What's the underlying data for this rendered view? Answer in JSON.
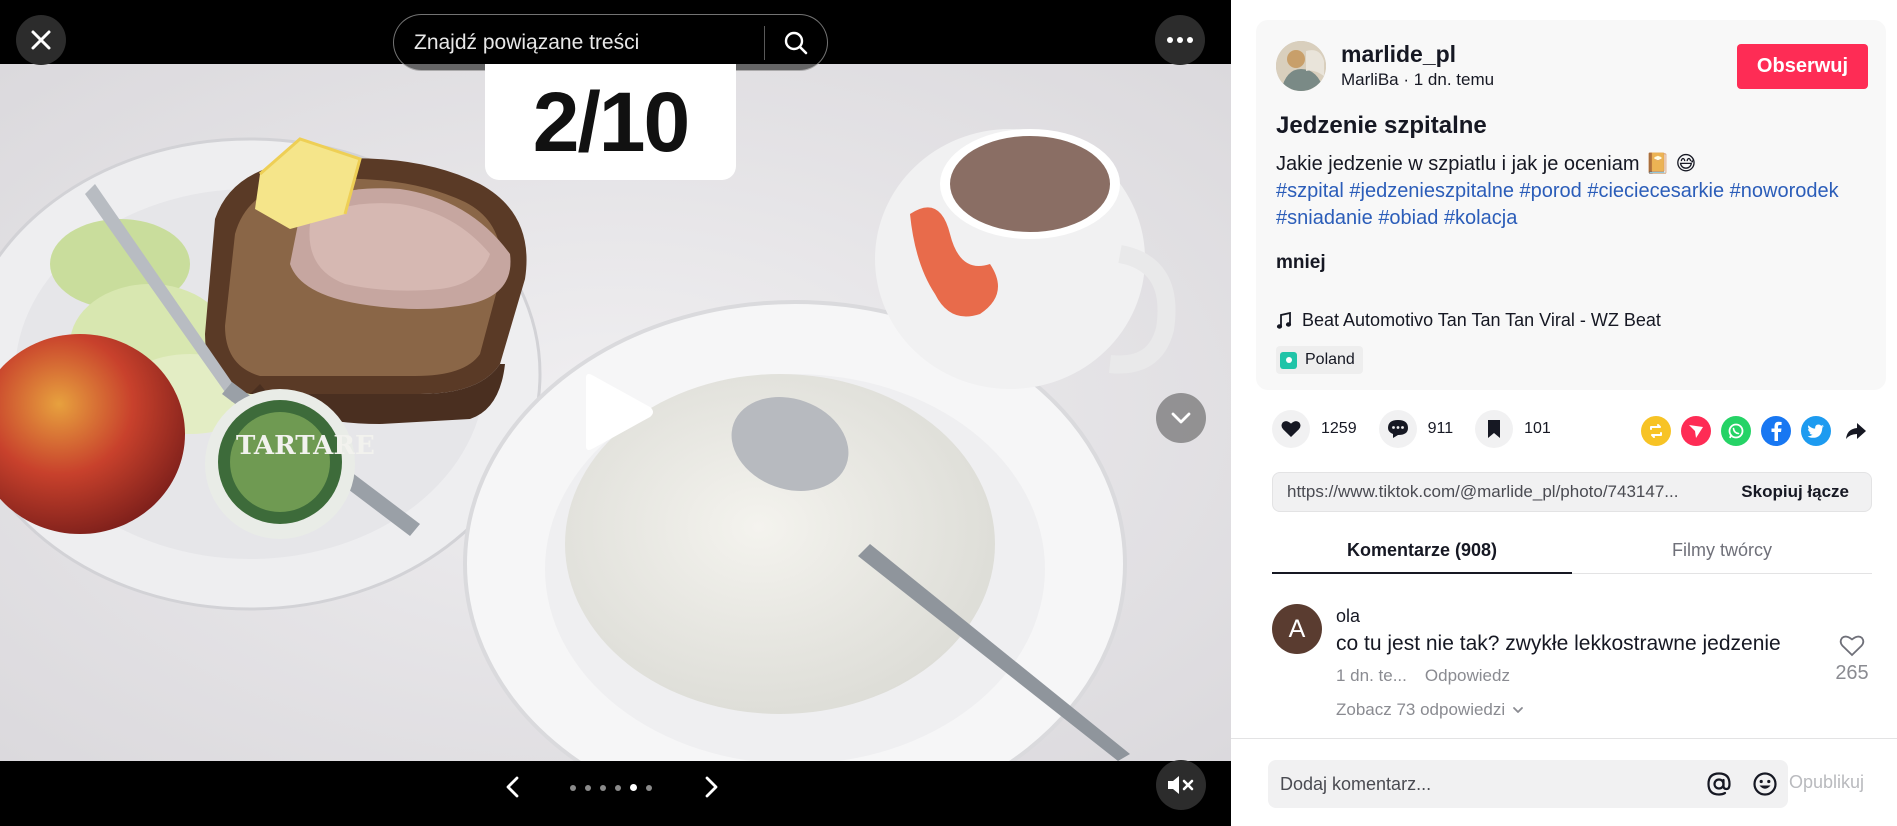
{
  "viewer": {
    "search_placeholder": "Znajdź powiązane treści",
    "slide_counter": "2/10",
    "slide_dots": {
      "total": 6,
      "active_index": 4
    }
  },
  "author": {
    "username": "marlide_pl",
    "display_name": "MarliBa",
    "separator": " · ",
    "posted": "1 dn. temu",
    "follow_label": "Obserwuj"
  },
  "post": {
    "title": "Jedzenie szpitalne",
    "description": "Jakie jedzenie w szpiatlu i jak je oceniam 📔 😅",
    "hashtags": [
      "#szpital",
      "#jedzenieszpitalne",
      "#porod",
      "#cieciecesarkie",
      "#noworodek",
      "#sniadanie",
      "#obiad",
      "#kolacja"
    ],
    "less_label": "mniej",
    "music": "Beat Automotivo Tan Tan Tan Viral - WZ Beat",
    "location": "Poland"
  },
  "stats": {
    "likes": "1259",
    "comments": "911",
    "saves": "101"
  },
  "share_icons": [
    {
      "name": "repost-icon",
      "color": "#f7c325"
    },
    {
      "name": "send-icon",
      "color": "#fe2c55"
    },
    {
      "name": "whatsapp-icon",
      "color": "#25d366"
    },
    {
      "name": "facebook-icon",
      "color": "#1877f2"
    },
    {
      "name": "twitter-icon",
      "color": "#1d9bf0"
    },
    {
      "name": "share-arrow-icon",
      "color": "#161823"
    }
  ],
  "link": {
    "url": "https://www.tiktok.com/@marlide_pl/photo/743147...",
    "copy_label": "Skopiuj łącze"
  },
  "tabs": [
    {
      "label": "Komentarze (908)",
      "active": true
    },
    {
      "label": "Filmy twórcy",
      "active": false
    }
  ],
  "comments": [
    {
      "avatar_letter": "A",
      "user": "ola",
      "text": "co tu jest nie tak? zwykłe lekkostrawne jedzenie",
      "time": "1 dn. te...",
      "reply_label": "Odpowiedz",
      "likes": "265",
      "view_replies": "Zobacz 73 odpowiedzi"
    }
  ],
  "comment_bar": {
    "placeholder": "Dodaj komentarz...",
    "post_label": "Opublikuj"
  },
  "colors": {
    "accent": "#fe2c55",
    "hashtag": "#2b5db9"
  }
}
